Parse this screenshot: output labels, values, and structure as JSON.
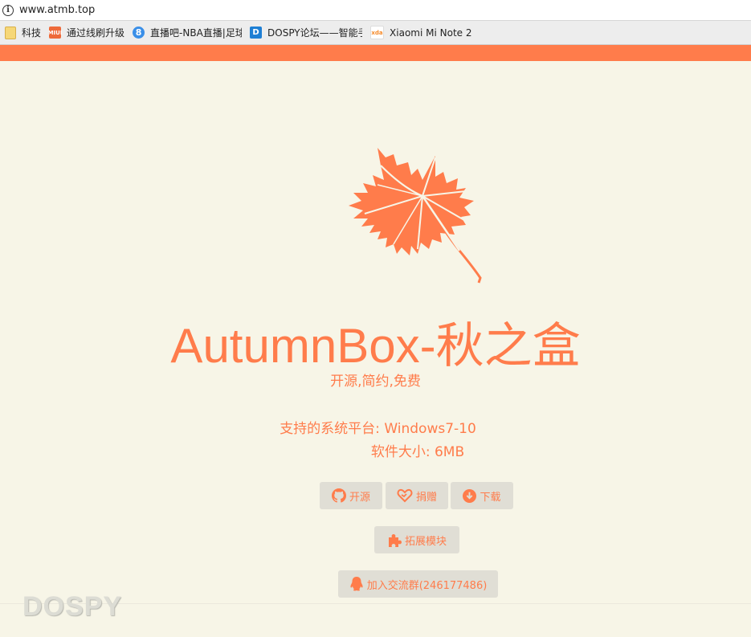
{
  "browser": {
    "url": "www.atmb.top",
    "bookmarks": [
      {
        "label": "科技",
        "icon": "folder-icon"
      },
      {
        "label": "通过线刷升级",
        "icon": "miui-icon",
        "icon_text": "MIUI"
      },
      {
        "label": "直播吧-NBA直播|足球直",
        "icon": "zhibo8-icon",
        "icon_text": "8"
      },
      {
        "label": "DOSPY论坛——智能手",
        "icon": "dospy-icon",
        "icon_text": "D"
      },
      {
        "label": "Xiaomi Mi Note 2",
        "icon": "xda-icon",
        "icon_text": "xda"
      }
    ]
  },
  "colors": {
    "accent": "#ff7c4b",
    "background": "#f7f5e7",
    "button_bg": "#e0ded5"
  },
  "hero": {
    "title": "AutumnBox-秋之盒",
    "subtitle": "开源,简约,免费",
    "platform": "支持的系统平台: Windows7-10",
    "size": "软件大小: 6MB"
  },
  "buttons": {
    "open_source": "开源",
    "donate": "捐赠",
    "download": "下载",
    "extensions": "拓展模块",
    "join_group": "加入交流群(246177486)"
  },
  "watermark": "DOSPY"
}
